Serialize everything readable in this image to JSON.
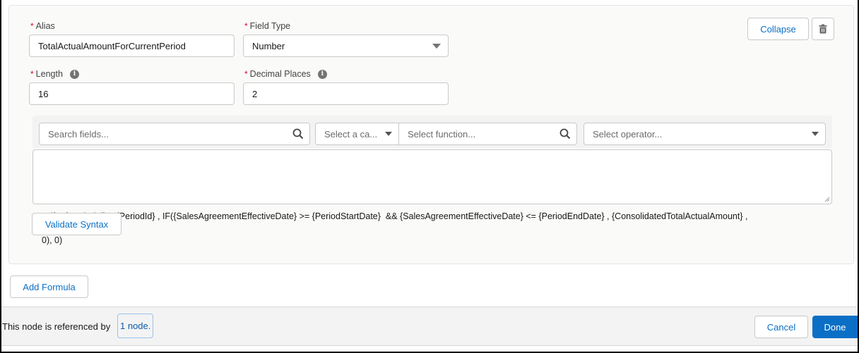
{
  "formula_card": {
    "alias": {
      "label": "Alias",
      "required": true,
      "value": "TotalActualAmountForCurrentPeriod"
    },
    "field_type": {
      "label": "Field Type",
      "required": true,
      "value": "Number"
    },
    "length": {
      "label": "Length",
      "required": true,
      "value": "16",
      "info_icon": "info-icon"
    },
    "decimal_places": {
      "label": "Decimal Places",
      "required": true,
      "value": "2",
      "info_icon": "info-icon"
    },
    "collapse_label": "Collapse",
    "delete_icon": "trash-icon",
    "toolbar": {
      "search_fields_placeholder": "Search fields...",
      "category_placeholder": "Select a ca...",
      "function_placeholder": "Select function...",
      "operator_placeholder": "Select operator..."
    },
    "formula_text": "IF({LeftPeriodId}=={PeriodId} , IF({SalesAgreementEffectiveDate} >= {PeriodStartDate}  && {SalesAgreementEffectiveDate} <= {PeriodEndDate} , {ConsolidatedTotalActualAmount} ,\n0), 0)",
    "validate_label": "Validate Syntax"
  },
  "add_formula_label": "Add Formula",
  "footer": {
    "reference_text": "This node is referenced by",
    "reference_link": "1 node.",
    "cancel_label": "Cancel",
    "done_label": "Done"
  },
  "colors": {
    "accent": "#0b6fc5",
    "required": "#ea001e"
  }
}
